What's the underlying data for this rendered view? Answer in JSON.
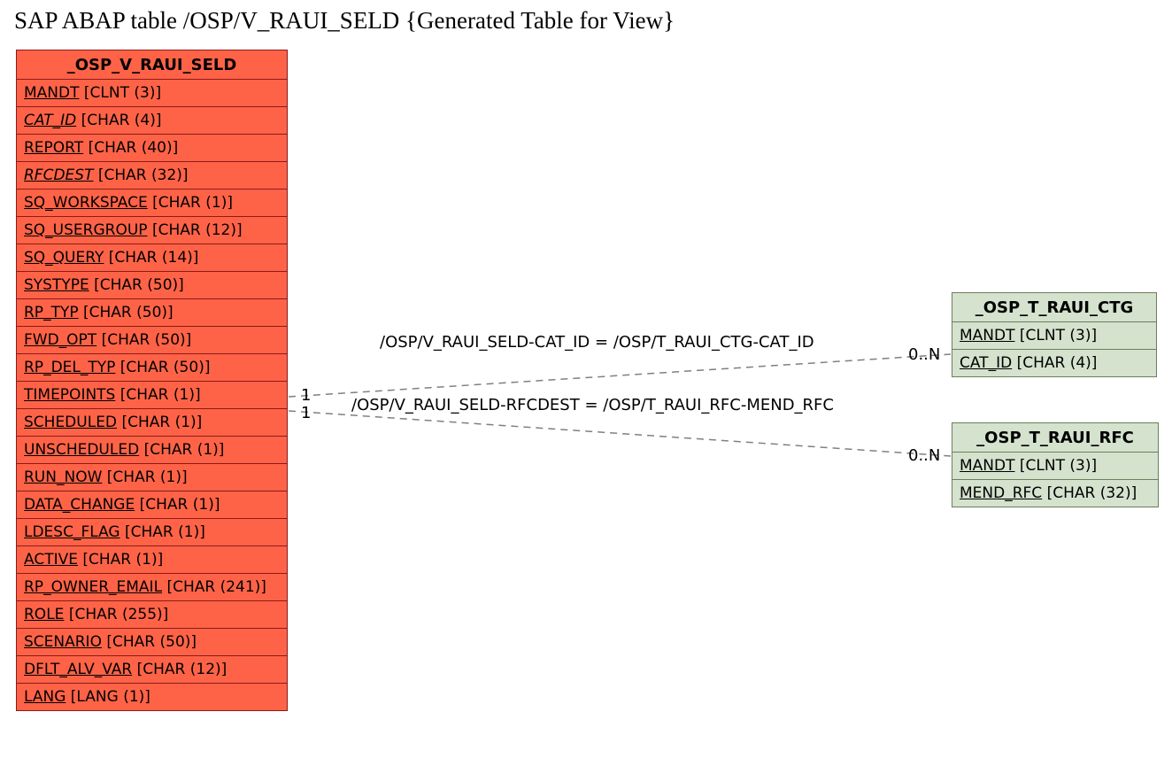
{
  "title": "SAP ABAP table /OSP/V_RAUI_SELD {Generated Table for View}",
  "main_table": {
    "header": "_OSP_V_RAUI_SELD",
    "fields": [
      {
        "name": "MANDT",
        "type": "[CLNT (3)]",
        "italic": false
      },
      {
        "name": "CAT_ID",
        "type": "[CHAR (4)]",
        "italic": true
      },
      {
        "name": "REPORT",
        "type": "[CHAR (40)]",
        "italic": false
      },
      {
        "name": "RFCDEST",
        "type": "[CHAR (32)]",
        "italic": true
      },
      {
        "name": "SQ_WORKSPACE",
        "type": "[CHAR (1)]",
        "italic": false
      },
      {
        "name": "SQ_USERGROUP",
        "type": "[CHAR (12)]",
        "italic": false
      },
      {
        "name": "SQ_QUERY",
        "type": "[CHAR (14)]",
        "italic": false
      },
      {
        "name": "SYSTYPE",
        "type": "[CHAR (50)]",
        "italic": false
      },
      {
        "name": "RP_TYP",
        "type": "[CHAR (50)]",
        "italic": false
      },
      {
        "name": "FWD_OPT",
        "type": "[CHAR (50)]",
        "italic": false
      },
      {
        "name": "RP_DEL_TYP",
        "type": "[CHAR (50)]",
        "italic": false
      },
      {
        "name": "TIMEPOINTS",
        "type": "[CHAR (1)]",
        "italic": false
      },
      {
        "name": "SCHEDULED",
        "type": "[CHAR (1)]",
        "italic": false
      },
      {
        "name": "UNSCHEDULED",
        "type": "[CHAR (1)]",
        "italic": false
      },
      {
        "name": "RUN_NOW",
        "type": "[CHAR (1)]",
        "italic": false
      },
      {
        "name": "DATA_CHANGE",
        "type": "[CHAR (1)]",
        "italic": false
      },
      {
        "name": "LDESC_FLAG",
        "type": "[CHAR (1)]",
        "italic": false
      },
      {
        "name": "ACTIVE",
        "type": "[CHAR (1)]",
        "italic": false
      },
      {
        "name": "RP_OWNER_EMAIL",
        "type": "[CHAR (241)]",
        "italic": false
      },
      {
        "name": "ROLE",
        "type": "[CHAR (255)]",
        "italic": false
      },
      {
        "name": "SCENARIO",
        "type": "[CHAR (50)]",
        "italic": false
      },
      {
        "name": "DFLT_ALV_VAR",
        "type": "[CHAR (12)]",
        "italic": false
      },
      {
        "name": "LANG",
        "type": "[LANG (1)]",
        "italic": false
      }
    ]
  },
  "ctg_table": {
    "header": "_OSP_T_RAUI_CTG",
    "fields": [
      {
        "name": "MANDT",
        "type": "[CLNT (3)]"
      },
      {
        "name": "CAT_ID",
        "type": "[CHAR (4)]"
      }
    ]
  },
  "rfc_table": {
    "header": "_OSP_T_RAUI_RFC",
    "fields": [
      {
        "name": "MANDT",
        "type": "[CLNT (3)]"
      },
      {
        "name": "MEND_RFC",
        "type": "[CHAR (32)]"
      }
    ]
  },
  "rel1_text": "/OSP/V_RAUI_SELD-CAT_ID = /OSP/T_RAUI_CTG-CAT_ID",
  "rel2_text": "/OSP/V_RAUI_SELD-RFCDEST = /OSP/T_RAUI_RFC-MEND_RFC",
  "card_left1": "1",
  "card_left2": "1",
  "card_right1": "0..N",
  "card_right2": "0..N"
}
